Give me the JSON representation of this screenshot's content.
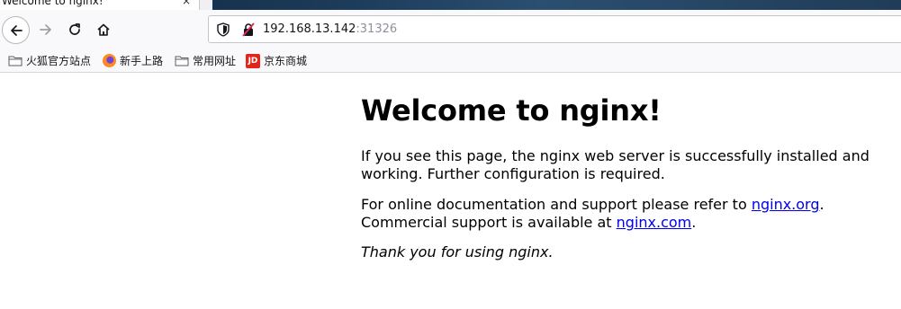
{
  "tab": {
    "title": "Welcome to nginx!",
    "close_glyph": "×"
  },
  "navbar": {
    "url_host": "192.168.13.142",
    "url_port": ":31326"
  },
  "bookmarks": [
    {
      "label": "火狐官方站点",
      "icon": "folder-icon"
    },
    {
      "label": "新手上路",
      "icon": "firefox-icon"
    },
    {
      "label": "常用网址",
      "icon": "folder-icon"
    },
    {
      "label": "京东商城",
      "icon": "jd-icon",
      "icon_text": "JD"
    }
  ],
  "page": {
    "title": "Welcome to nginx!",
    "p1_line1": "If you see this page, the nginx web server is successfully installed and",
    "p1_line2": "working. Further configuration is required.",
    "p2_line1_prefix": "For online documentation and support please refer to ",
    "p2_link1": "nginx.org",
    "p2_line1_suffix": ".",
    "p2_line2_prefix": "Commercial support is available at ",
    "p2_link2": "nginx.com",
    "p2_line2_suffix": ".",
    "p3": "Thank you for using nginx."
  },
  "colors": {
    "link": "#0000ee",
    "url_port": "#8f8f9d",
    "jd_red": "#e1251b"
  }
}
